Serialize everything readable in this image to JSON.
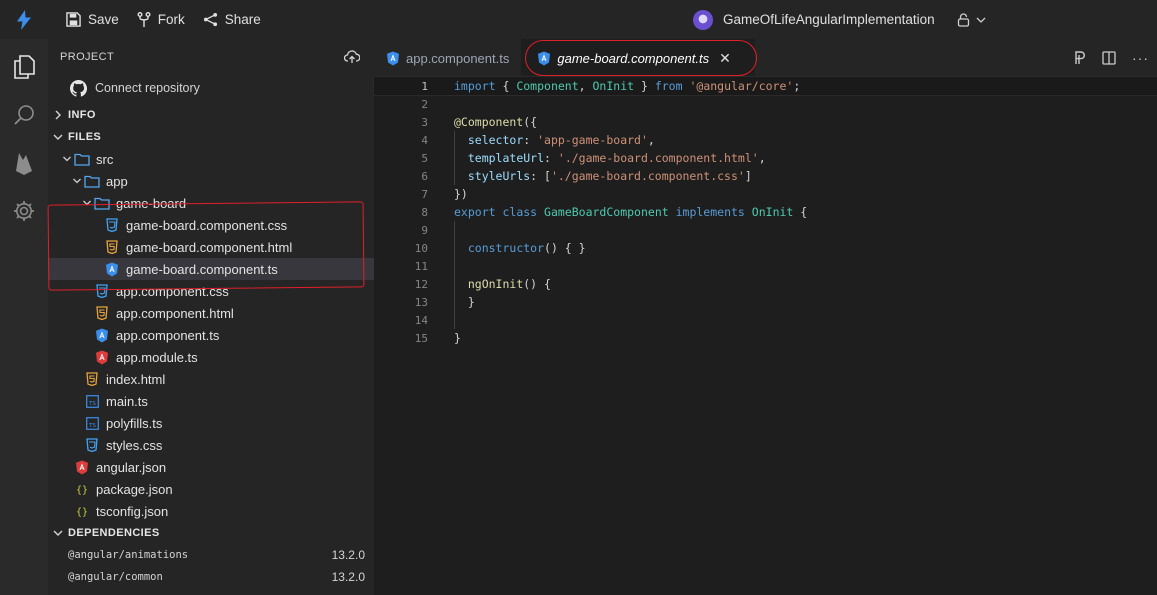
{
  "topbar": {
    "save_label": "Save",
    "fork_label": "Fork",
    "share_label": "Share",
    "project_name": "GameOfLifeAngularImplementation"
  },
  "sidebar": {
    "project_header": "PROJECT",
    "connect_repository": "Connect repository",
    "info_section": "INFO",
    "files_section": "FILES",
    "dependencies_section": "DEPENDENCIES",
    "tree": [
      {
        "label": "src",
        "kind": "folder"
      },
      {
        "label": "app",
        "kind": "folder"
      },
      {
        "label": "game-board",
        "kind": "folder"
      },
      {
        "label": "game-board.component.css",
        "kind": "css"
      },
      {
        "label": "game-board.component.html",
        "kind": "html"
      },
      {
        "label": "game-board.component.ts",
        "kind": "ts-angular"
      },
      {
        "label": "app.component.css",
        "kind": "css"
      },
      {
        "label": "app.component.html",
        "kind": "html"
      },
      {
        "label": "app.component.ts",
        "kind": "ts-angular"
      },
      {
        "label": "app.module.ts",
        "kind": "angular"
      },
      {
        "label": "index.html",
        "kind": "html"
      },
      {
        "label": "main.ts",
        "kind": "ts"
      },
      {
        "label": "polyfills.ts",
        "kind": "ts"
      },
      {
        "label": "styles.css",
        "kind": "css"
      },
      {
        "label": "angular.json",
        "kind": "angular"
      },
      {
        "label": "package.json",
        "kind": "json"
      },
      {
        "label": "tsconfig.json",
        "kind": "json"
      }
    ],
    "dependencies": [
      {
        "name": "@angular/animations",
        "version": "13.2.0"
      },
      {
        "name": "@angular/common",
        "version": "13.2.0"
      }
    ]
  },
  "editor": {
    "tabs": [
      {
        "label": "app.component.ts",
        "active": false
      },
      {
        "label": "game-board.component.ts",
        "active": true
      }
    ],
    "line_numbers": [
      "1",
      "2",
      "3",
      "4",
      "5",
      "6",
      "7",
      "8",
      "9",
      "10",
      "11",
      "12",
      "13",
      "14",
      "15"
    ]
  },
  "colors": {
    "annotation": "#e01f2a",
    "accent": "#3b8eea",
    "angular_red": "#dd3c3c",
    "html_orange": "#e8a33d"
  }
}
